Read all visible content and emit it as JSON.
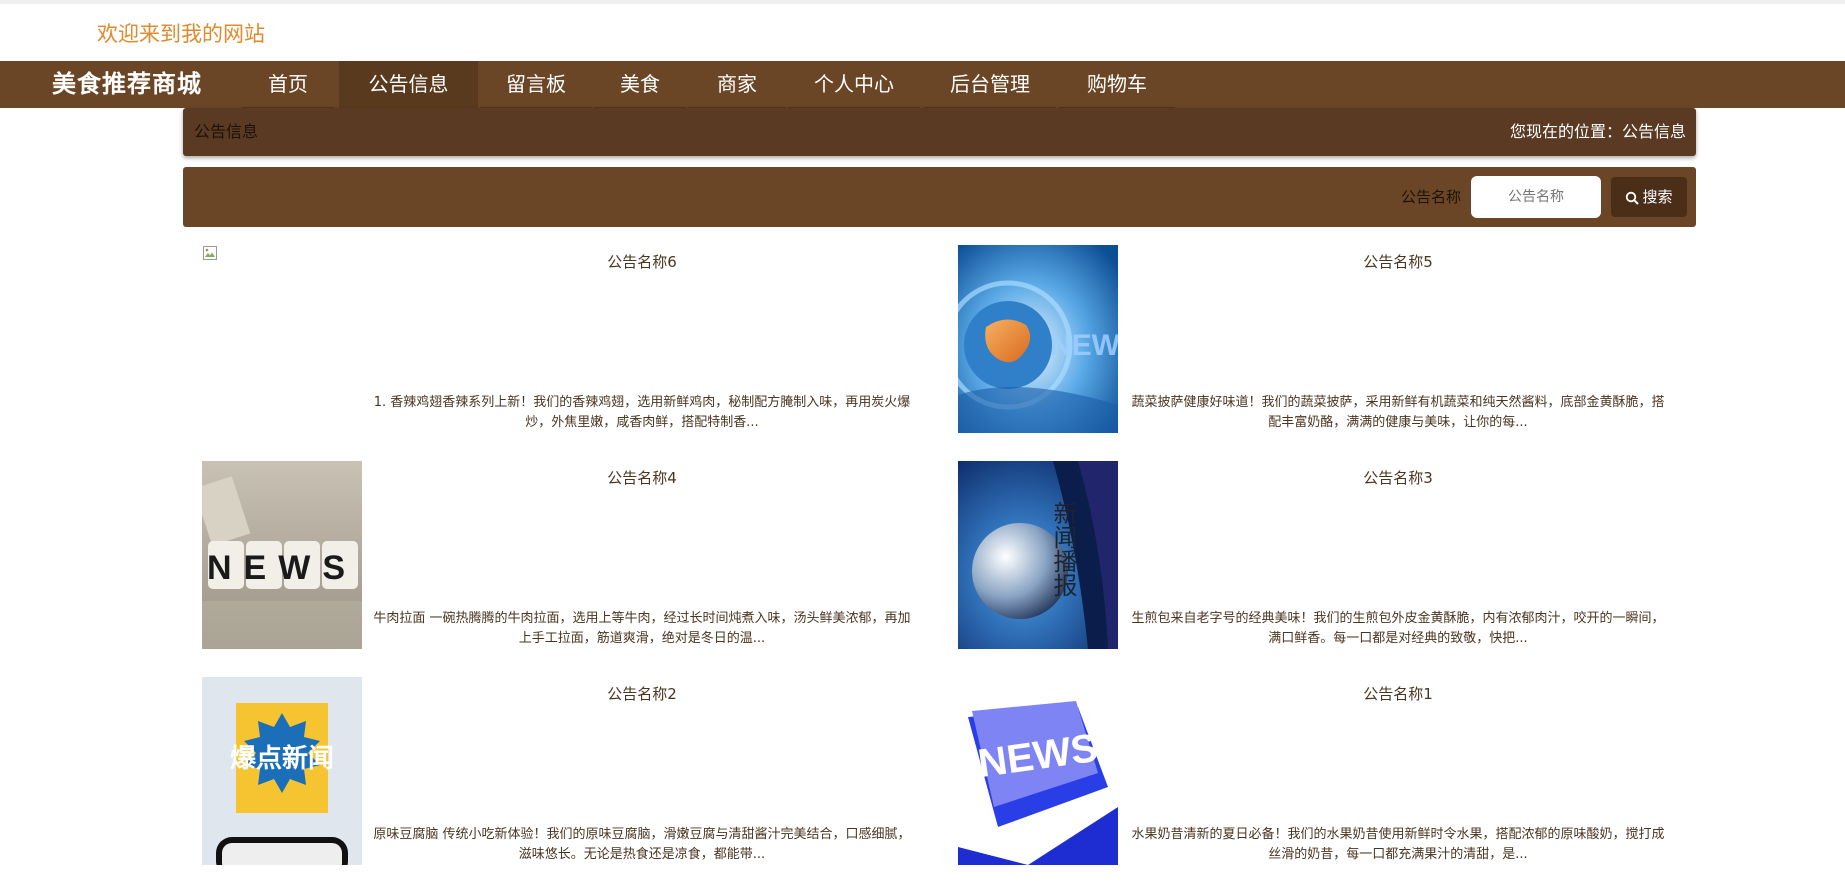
{
  "header": {
    "welcome": "欢迎来到我的网站"
  },
  "nav": {
    "brand": "美食推荐商城",
    "items": [
      {
        "label": "首页"
      },
      {
        "label": "公告信息"
      },
      {
        "label": "留言板"
      },
      {
        "label": "美食"
      },
      {
        "label": "商家"
      },
      {
        "label": "个人中心"
      },
      {
        "label": "后台管理"
      },
      {
        "label": "购物车"
      }
    ],
    "active_index": 1
  },
  "breadcrumb": {
    "current": "公告信息",
    "location_label": "您现在的位置：",
    "location": "公告信息"
  },
  "search": {
    "label": "公告名称",
    "placeholder": "公告名称",
    "value": "",
    "button_label": "搜索"
  },
  "announcements": [
    {
      "title": "公告名称6",
      "desc": "1. 香辣鸡翅香辣系列上新！我们的香辣鸡翅，选用新鲜鸡肉，秘制配方腌制入味，再用炭火爆炒，外焦里嫩，咸香肉鲜，搭配特制香...",
      "image": "broken-image"
    },
    {
      "title": "公告名称5",
      "desc": "蔬菜披萨健康好味道！我们的蔬菜披萨，采用新鲜有机蔬菜和纯天然酱料，底部金黄酥脆，搭配丰富奶酪，满满的健康与美味，让你的每...",
      "image": "news-globe-image",
      "image_text": "NEWS"
    },
    {
      "title": "公告名称4",
      "desc": "牛肉拉面 一碗热腾腾的牛肉拉面，选用上等牛肉，经过长时间炖煮入味，汤头鲜美浓郁，再加上手工拉面，筋道爽滑，绝对是冬日的温...",
      "image": "news-dice-image",
      "image_text": "NEWS"
    },
    {
      "title": "公告名称3",
      "desc": "生煎包来自老字号的经典美味！我们的生煎包外皮金黄酥脆，内有浓郁肉汁，咬开的一瞬间，满口鲜香。每一口都是对经典的致敬，快把...",
      "image": "news-broadcast-image",
      "image_text": "新闻播报"
    },
    {
      "title": "公告名称2",
      "desc": "原味豆腐脑 传统小吃新体验！我们的原味豆腐脑，滑嫩豆腐与清甜酱汁完美结合，口感细腻，滋味悠长。无论是热食还是凉食，都能带...",
      "image": "breaking-news-image",
      "image_text": "爆点新闻"
    },
    {
      "title": "公告名称1",
      "desc": "水果奶昔清新的夏日必备！我们的水果奶昔使用新鲜时令水果，搭配浓郁的原味酸奶，搅打成丝滑的奶昔，每一口都充满果汁的清甜，是...",
      "image": "news-key-image",
      "image_text": "NEWS"
    }
  ],
  "colors": {
    "nav_bg": "#6b4626",
    "nav_active": "#5a3a1e",
    "breadcrumb_bg": "#5a3a22",
    "welcome_text": "#e08a2e",
    "text": "#4a3520"
  }
}
